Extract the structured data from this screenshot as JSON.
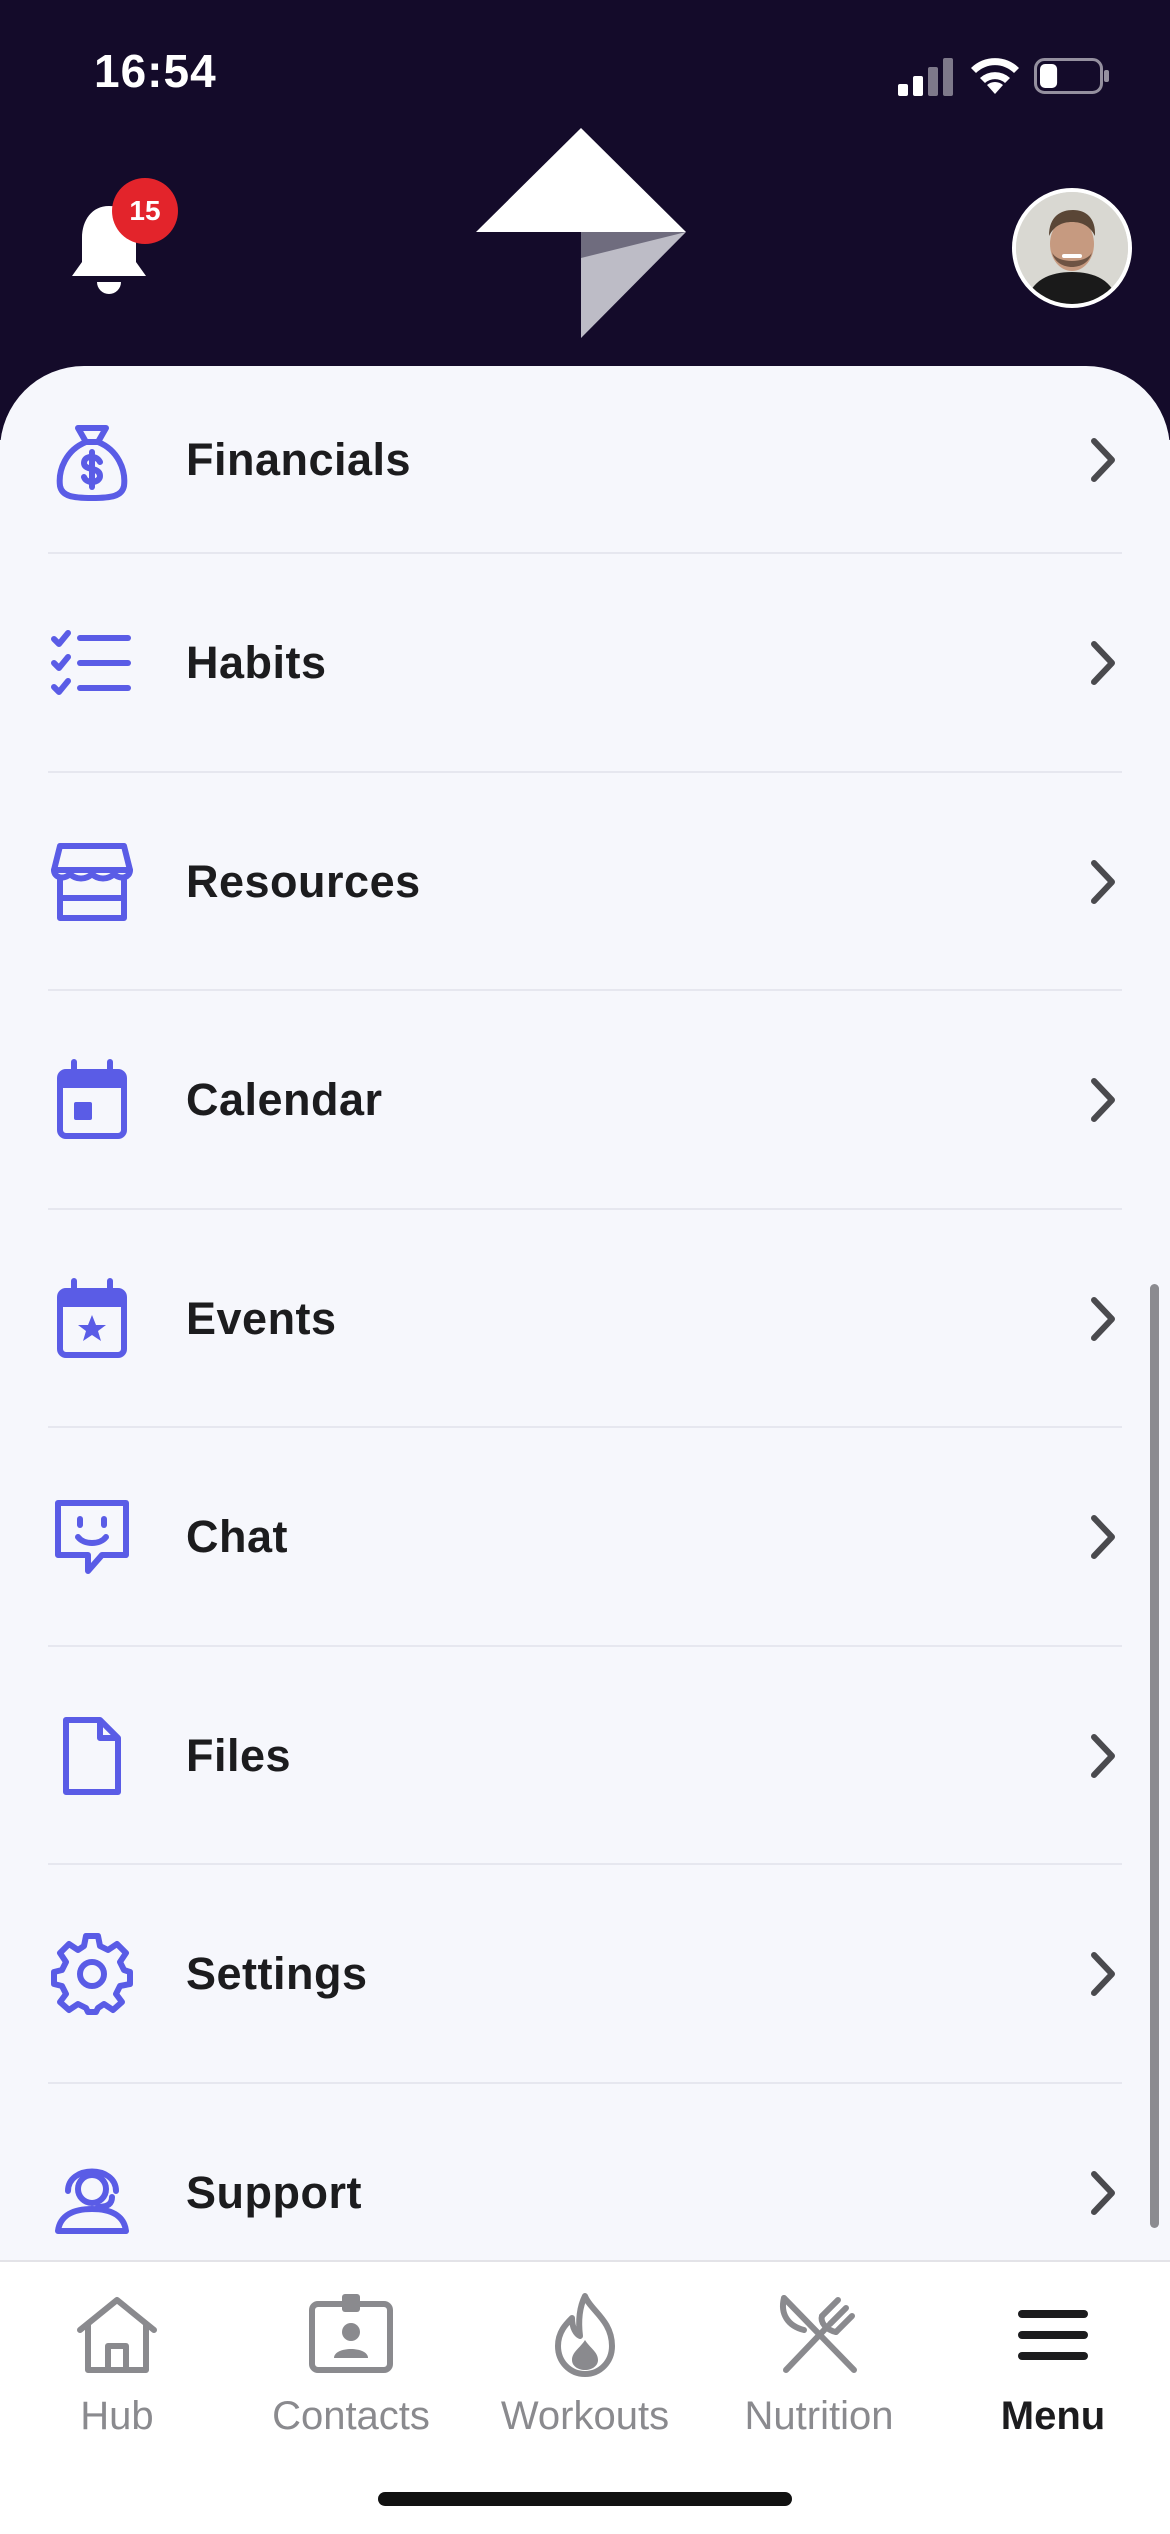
{
  "status_bar": {
    "time": "16:54",
    "battery_level": 0.3
  },
  "header": {
    "notification_count": "15"
  },
  "colors": {
    "header_bg": "#140b2a",
    "accent": "#5a5ce6",
    "badge": "#e3242b"
  },
  "menu": {
    "items": [
      {
        "label": "Financials",
        "icon": "money-bag-icon"
      },
      {
        "label": "Habits",
        "icon": "checklist-icon"
      },
      {
        "label": "Resources",
        "icon": "storefront-icon"
      },
      {
        "label": "Calendar",
        "icon": "calendar-icon"
      },
      {
        "label": "Events",
        "icon": "calendar-star-icon"
      },
      {
        "label": "Chat",
        "icon": "chat-smile-icon"
      },
      {
        "label": "Files",
        "icon": "file-icon"
      },
      {
        "label": "Settings",
        "icon": "gear-icon"
      },
      {
        "label": "Support",
        "icon": "support-agent-icon"
      }
    ]
  },
  "tabbar": {
    "tabs": [
      {
        "label": "Hub",
        "icon": "home-icon",
        "active": false
      },
      {
        "label": "Contacts",
        "icon": "contact-card-icon",
        "active": false
      },
      {
        "label": "Workouts",
        "icon": "flame-icon",
        "active": false
      },
      {
        "label": "Nutrition",
        "icon": "utensils-icon",
        "active": false
      },
      {
        "label": "Menu",
        "icon": "hamburger-menu-icon",
        "active": true
      }
    ]
  }
}
